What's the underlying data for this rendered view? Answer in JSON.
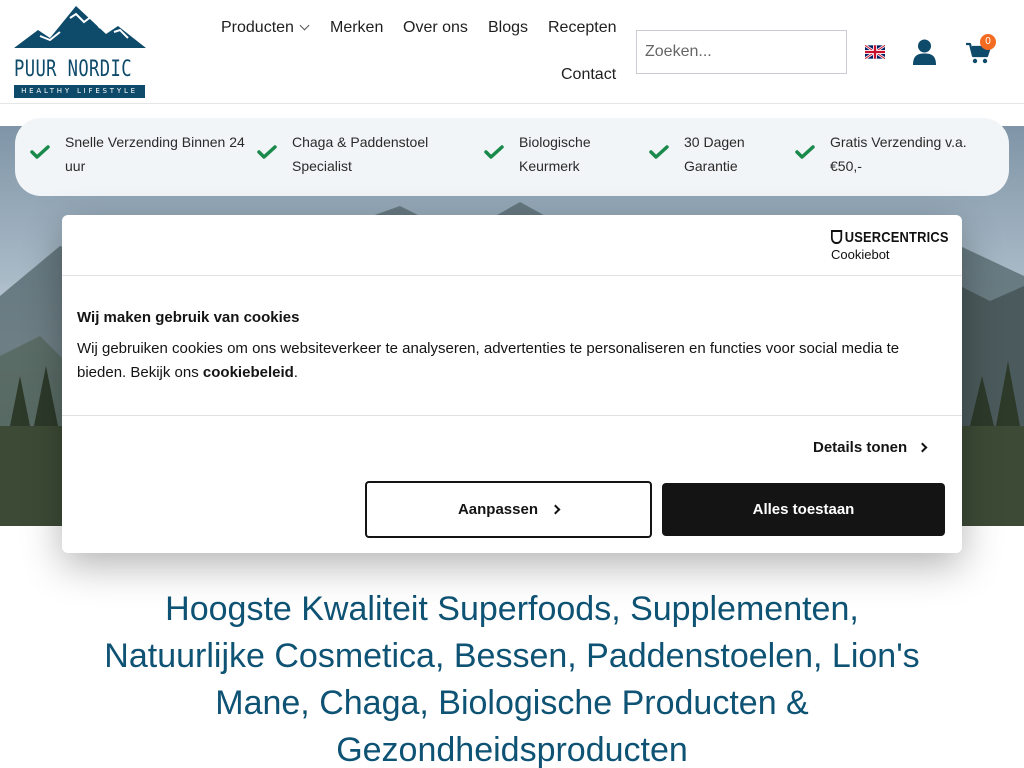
{
  "logo": {
    "brand": "PUUR NORDIC",
    "tagline": "HEALTHY LIFESTYLE",
    "brand_color": "#0e4a6a"
  },
  "nav": {
    "products": "Producten",
    "brands": "Merken",
    "about": "Over ons",
    "blogs": "Blogs",
    "recipes": "Recepten",
    "contact": "Contact"
  },
  "search": {
    "placeholder": "Zoeken...",
    "value": ""
  },
  "header_icons": {
    "language_flag": "uk-flag-icon",
    "account": "user-icon",
    "cart": "cart-icon",
    "cart_count": "0",
    "cart_badge_color": "#f36b21"
  },
  "usps": [
    {
      "text": "Snelle Verzending Binnen 24 uur",
      "icon": "check-icon"
    },
    {
      "text": "Chaga & Paddenstoel Specialist",
      "icon": "check-icon"
    },
    {
      "text": "Biologische Keurmerk",
      "icon": "check-icon"
    },
    {
      "text": "30 Dagen Garantie",
      "icon": "check-icon"
    },
    {
      "text": "Gratis Verzending v.a. €50,-",
      "icon": "check-icon"
    }
  ],
  "usp_check_color": "#1a8a4c",
  "cookie_dialog": {
    "provider_line1": "USERCENTRICS",
    "provider_line2": "Cookiebot",
    "title": "Wij maken gebruik van cookies",
    "text_before_link": "Wij gebruiken cookies om ons websiteverkeer te analyseren, advertenties te personaliseren en functies voor social media te bieden. Bekijk ons ",
    "link_text": "cookiebeleid",
    "text_after_link": ".",
    "details_label": "Details tonen",
    "customize_label": "Aanpassen",
    "allow_all_label": "Alles toestaan"
  },
  "headline": "Hoogste Kwaliteit Superfoods, Supplementen, Natuurlijke Cosmetica, Bessen, Paddenstoelen, Lion's Mane, Chaga, Biologische Producten & Gezondheidsproducten",
  "headline_color": "#0e5274"
}
